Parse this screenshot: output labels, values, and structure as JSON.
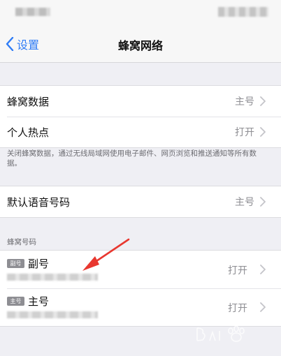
{
  "nav": {
    "back_label": "设置",
    "title": "蜂窝网络"
  },
  "group1": {
    "rows": [
      {
        "label": "蜂窝数据",
        "value": "主号"
      },
      {
        "label": "个人热点",
        "value": "打开"
      }
    ]
  },
  "footnote": "关闭蜂窝数据，通过无线局域网使用电子邮件、网页浏览和推送通知等所有数据。",
  "group2": {
    "rows": [
      {
        "label": "默认语音号码",
        "value": "主号"
      }
    ]
  },
  "sim_section": {
    "header": "蜂窝号码",
    "items": [
      {
        "badge": "副号",
        "name": "副号",
        "value": "打开"
      },
      {
        "badge": "主号",
        "name": "主号",
        "value": "打开"
      }
    ]
  },
  "colors": {
    "accent": "#2f7cf6",
    "background": "#efeff4",
    "annotation_arrow": "#e8372f"
  },
  "icons": {
    "back": "chevron-left-icon",
    "disclosure": "chevron-right-icon"
  }
}
